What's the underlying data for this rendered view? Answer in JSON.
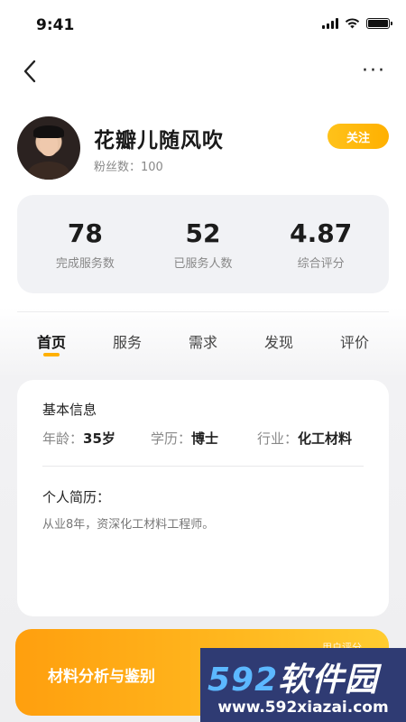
{
  "status_bar": {
    "time": "9:41"
  },
  "profile": {
    "name": "花瓣儿随风吹",
    "fans": "粉丝数：100",
    "follow_label": "关注"
  },
  "stats": [
    {
      "value": "78",
      "label": "完成服务数"
    },
    {
      "value": "52",
      "label": "已服务人数"
    },
    {
      "value": "4.87",
      "label": "综合评分"
    }
  ],
  "tabs": [
    "首页",
    "服务",
    "需求",
    "发现",
    "评价"
  ],
  "info": {
    "basic_title": "基本信息",
    "age_key": "年龄：",
    "age_val": "35岁",
    "edu_key": "学历：",
    "edu_val": "博士",
    "industry_key": "行业：",
    "industry_val": "化工材料",
    "resume_title": "个人简历：",
    "resume_text": "从业8年，资深化工材料工程师。"
  },
  "banner": {
    "title": "材料分析与鉴别",
    "sub": "用户评分"
  },
  "watermark": {
    "logo_num": "592",
    "logo_text": "软件园",
    "url": "www.592xiazai.com"
  },
  "colors": {
    "accent": "#ffb000",
    "card_bg": "#f1f2f5"
  }
}
